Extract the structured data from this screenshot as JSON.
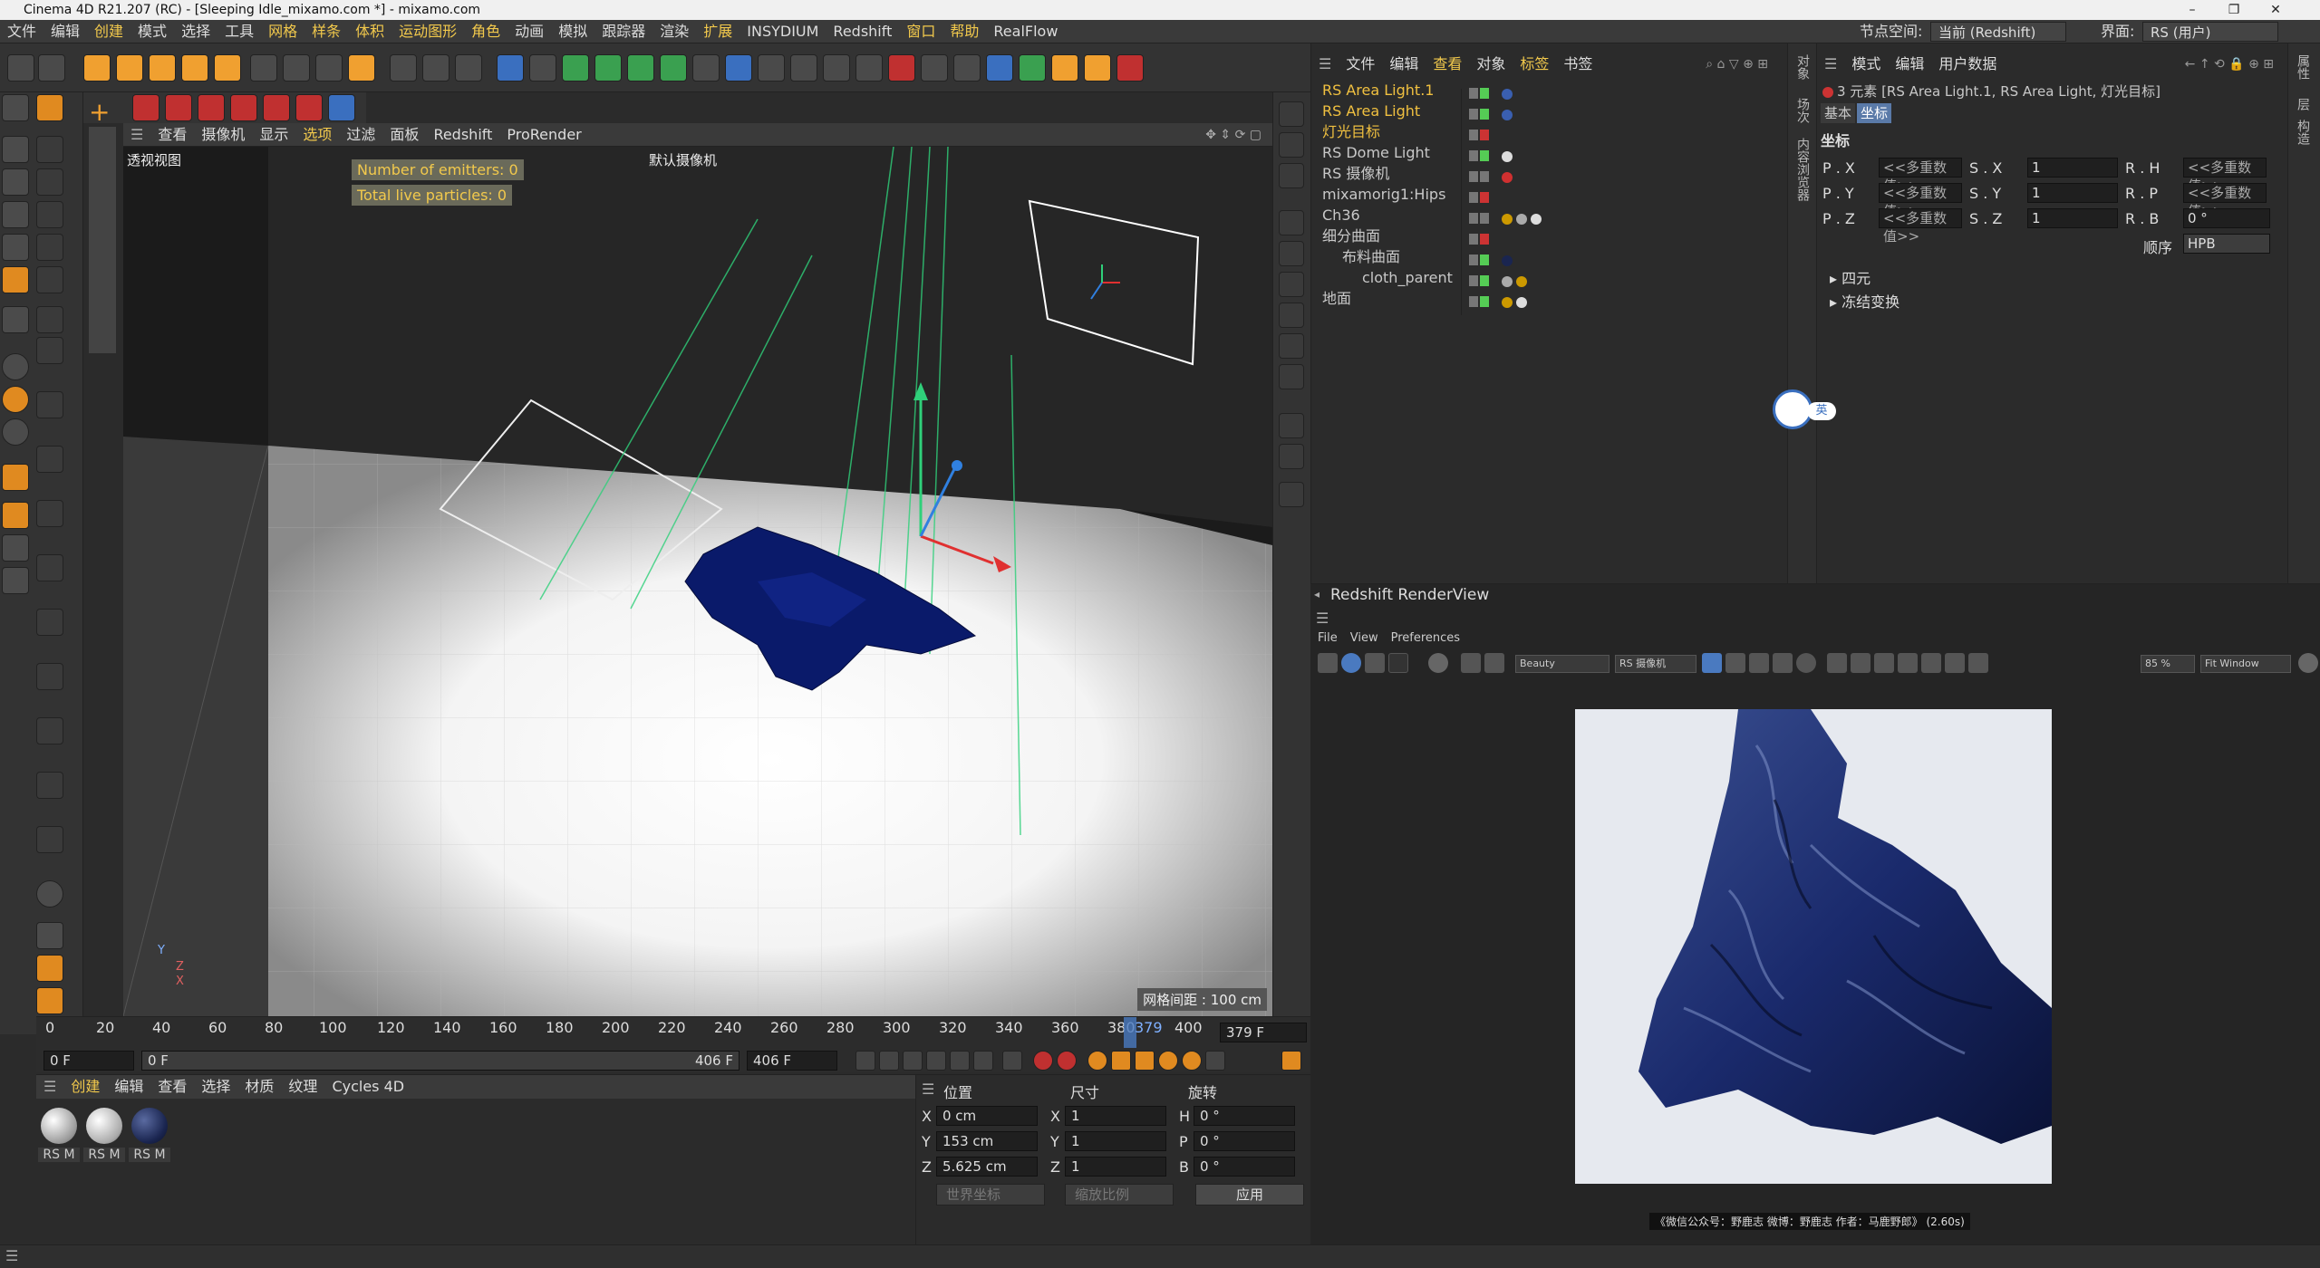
{
  "window": {
    "title": "Cinema 4D R21.207 (RC) - [Sleeping Idle_mixamo.com *] - mixamo.com"
  },
  "menubar": {
    "items": [
      "文件",
      "编辑",
      "创建",
      "模式",
      "选择",
      "工具",
      "网格",
      "样条",
      "体积",
      "运动图形",
      "角色",
      "动画",
      "模拟",
      "跟踪器",
      "渲染",
      "扩展",
      "INSYDIUM",
      "Redshift",
      "窗口",
      "帮助",
      "RealFlow"
    ],
    "node_space_label": "节点空间:",
    "node_space_value": "当前 (Redshift)",
    "layout_label": "界面:",
    "layout_value": "RS (用户)"
  },
  "viewport": {
    "menu": [
      "查看",
      "摄像机",
      "显示",
      "选项",
      "过滤",
      "面板",
      "Redshift",
      "ProRender"
    ],
    "view_name": "透视视图",
    "camera_name": "默认摄像机",
    "emitters": "Number of emitters: 0",
    "particles": "Total live particles: 0",
    "grid_info": "网格间距 : 100 cm",
    "axis": {
      "x": "X",
      "y": "Y",
      "z": "Z"
    }
  },
  "timeline": {
    "ticks": [
      "0",
      "20",
      "40",
      "60",
      "80",
      "100",
      "120",
      "140",
      "160",
      "180",
      "200",
      "220",
      "240",
      "260",
      "280",
      "300",
      "320",
      "340",
      "360",
      "380",
      "400"
    ],
    "current": "379",
    "current_field": "379 F",
    "start_field": "0 F",
    "range_start": "0 F",
    "range_end": "406 F",
    "end_field": "406 F"
  },
  "materials": {
    "menu": [
      "创建",
      "编辑",
      "查看",
      "选择",
      "材质",
      "纹理",
      "Cycles 4D"
    ],
    "items": [
      {
        "label": "RS M",
        "color": "#e8e8e8"
      },
      {
        "label": "RS M",
        "color": "#dcdcdc"
      },
      {
        "label": "RS M",
        "color": "#1a2550"
      }
    ]
  },
  "coords": {
    "headers": [
      "位置",
      "尺寸",
      "旋转"
    ],
    "rows": [
      {
        "axis": "X",
        "pos": "0 cm",
        "size_axis": "X",
        "size": "1",
        "rot_axis": "H",
        "rot": "0 °"
      },
      {
        "axis": "Y",
        "pos": "153 cm",
        "size_axis": "Y",
        "size": "1",
        "rot_axis": "P",
        "rot": "0 °"
      },
      {
        "axis": "Z",
        "pos": "5.625 cm",
        "size_axis": "Z",
        "size": "1",
        "rot_axis": "B",
        "rot": "0 °"
      }
    ],
    "world_dropdown": "世界坐标",
    "scale_dropdown": "缩放比例",
    "apply": "应用"
  },
  "objects": {
    "menu": [
      "文件",
      "编辑",
      "查看",
      "对象",
      "标签",
      "书签"
    ],
    "rows": [
      {
        "name": "RS Area Light.1",
        "color": "#f0c040",
        "indent": 0
      },
      {
        "name": "RS Area Light",
        "color": "#f0c040",
        "indent": 0
      },
      {
        "name": "灯光目标",
        "color": "#f0c040",
        "indent": 0
      },
      {
        "name": "RS Dome Light",
        "color": "#dddddd",
        "indent": 0
      },
      {
        "name": "RS 摄像机",
        "color": "#dddddd",
        "indent": 0
      },
      {
        "name": "mixamorig1:Hips",
        "color": "#dddddd",
        "indent": 0
      },
      {
        "name": "Ch36",
        "color": "#dddddd",
        "indent": 0
      },
      {
        "name": "细分曲面",
        "color": "#dddddd",
        "indent": 0
      },
      {
        "name": "布料曲面",
        "color": "#dddddd",
        "indent": 1
      },
      {
        "name": "cloth_parent",
        "color": "#dddddd",
        "indent": 2
      },
      {
        "name": "地面",
        "color": "#dddddd",
        "indent": 0
      }
    ]
  },
  "attributes": {
    "menu": [
      "模式",
      "编辑",
      "用户数据"
    ],
    "selection": "3 元素 [RS Area Light.1, RS Area Light, 灯光目标]",
    "tab_basic": "基本",
    "tab_coord": "坐标",
    "section": "坐标",
    "multi": "<<多重数值>>",
    "rows": [
      {
        "p": "P . X",
        "s": "S . X",
        "sval": "1",
        "r": "R . H"
      },
      {
        "p": "P . Y",
        "s": "S . Y",
        "sval": "1",
        "r": "R . P"
      },
      {
        "p": "P . Z",
        "s": "S . Z",
        "sval": "1",
        "r": "R . B"
      }
    ],
    "rb_value": "0 °",
    "order_label": "顺序",
    "order_value": "HPB",
    "quaternion": "四元",
    "freeze": "冻结变换"
  },
  "renderview": {
    "title": "Redshift RenderView",
    "menu": [
      "File",
      "View",
      "Preferences"
    ],
    "aov": "Beauty",
    "camera": "RS 摄像机",
    "zoom": "85 %",
    "fit": "Fit Window",
    "caption": "《微信公众号：野鹿志  微博：野鹿志  作者：马鹿野郎》 (2.60s)"
  },
  "ime": {
    "label": "英"
  },
  "colors": {
    "accent": "#f2c94c",
    "selected_obj": "#f0c040",
    "cloth": "#1a2a6c"
  }
}
